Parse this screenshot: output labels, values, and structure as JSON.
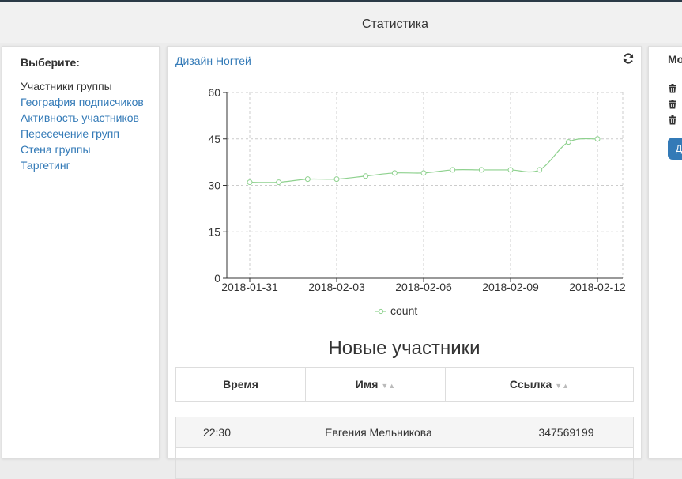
{
  "header": {
    "title": "Статистика"
  },
  "sidebar": {
    "heading": "Выберите:",
    "items": [
      {
        "label": "Участники группы",
        "active": true
      },
      {
        "label": "География подписчиков",
        "active": false
      },
      {
        "label": "Активность участников",
        "active": false
      },
      {
        "label": "Пересечение групп",
        "active": false
      },
      {
        "label": "Стена группы",
        "active": false
      },
      {
        "label": "Таргетинг",
        "active": false
      }
    ]
  },
  "chart_panel": {
    "group_link": "Дизайн Ногтей",
    "refresh_icon": "refresh-icon"
  },
  "chart_data": {
    "type": "line",
    "x": [
      "2018-01-31",
      "2018-02-01",
      "2018-02-02",
      "2018-02-03",
      "2018-02-04",
      "2018-02-05",
      "2018-02-06",
      "2018-02-07",
      "2018-02-08",
      "2018-02-09",
      "2018-02-10",
      "2018-02-11",
      "2018-02-12"
    ],
    "x_tick_labels": [
      "2018-01-31",
      "2018-02-03",
      "2018-02-06",
      "2018-02-09",
      "2018-02-12"
    ],
    "series": [
      {
        "name": "count",
        "values": [
          31,
          31,
          32,
          32,
          33,
          34,
          34,
          35,
          35,
          35,
          35,
          44,
          45
        ]
      }
    ],
    "ylim": [
      0,
      60
    ],
    "y_ticks": [
      0,
      15,
      30,
      45,
      60
    ],
    "grid": true,
    "legend_position": "bottom",
    "line_color": "#8ed18e"
  },
  "new_members": {
    "title": "Новые участники",
    "columns": [
      "Время",
      "Имя",
      "Ссылка"
    ],
    "rows": [
      {
        "time": "22:30",
        "name": "Евгения Мельникова",
        "link": "347569199"
      }
    ]
  },
  "right_panel": {
    "title_fragment": "Мо",
    "button_fragment": "Д",
    "trash_icon": "trash-icon"
  }
}
